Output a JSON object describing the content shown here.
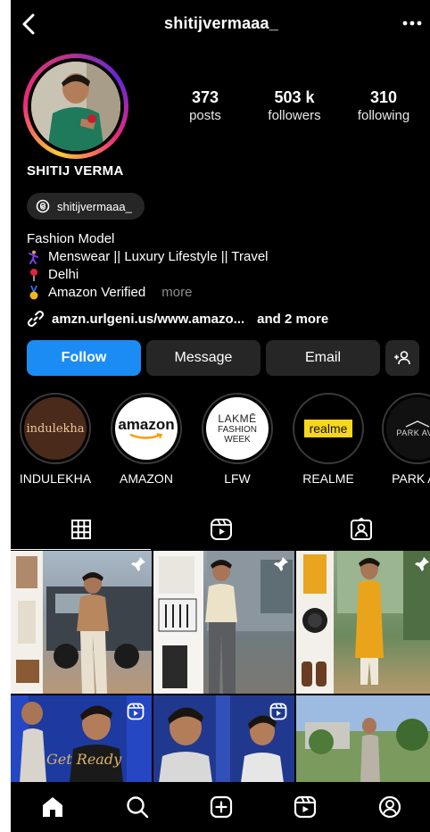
{
  "header": {
    "username": "shitijvermaaa_"
  },
  "stats": [
    {
      "value": "373",
      "label": "posts"
    },
    {
      "value": "503 k",
      "label": "followers"
    },
    {
      "value": "310",
      "label": "following"
    }
  ],
  "profile": {
    "full_name": "SHITIJ VERMA",
    "threads_handle": "shitijvermaaa_",
    "bio": {
      "line1": "Fashion Model",
      "line2": "Menswear || Luxury Lifestyle || Travel",
      "line3": "Delhi",
      "line4": "Amazon Verified",
      "more": "more"
    },
    "link": "amzn.urlgeni.us/www.amazo...",
    "link_more": "and 2 more"
  },
  "actions": {
    "follow": "Follow",
    "message": "Message",
    "email": "Email"
  },
  "highlights": [
    {
      "label": "INDULEKHA",
      "logo_text": "indulekha"
    },
    {
      "label": "AMAZON",
      "logo_text": "amazon"
    },
    {
      "label": "LFW",
      "logo_line1": "LAKMĒ",
      "logo_line2": "FASHION",
      "logo_line3": "WEEK"
    },
    {
      "label": "REALME",
      "logo_text": "realme"
    },
    {
      "label": "PARK AV",
      "logo_text": "PARK AVE"
    }
  ],
  "grid_overlay_text": "Get Ready",
  "colors": {
    "accent_blue": "#1a8cf4",
    "button_gray": "#262626",
    "background": "#000000"
  }
}
